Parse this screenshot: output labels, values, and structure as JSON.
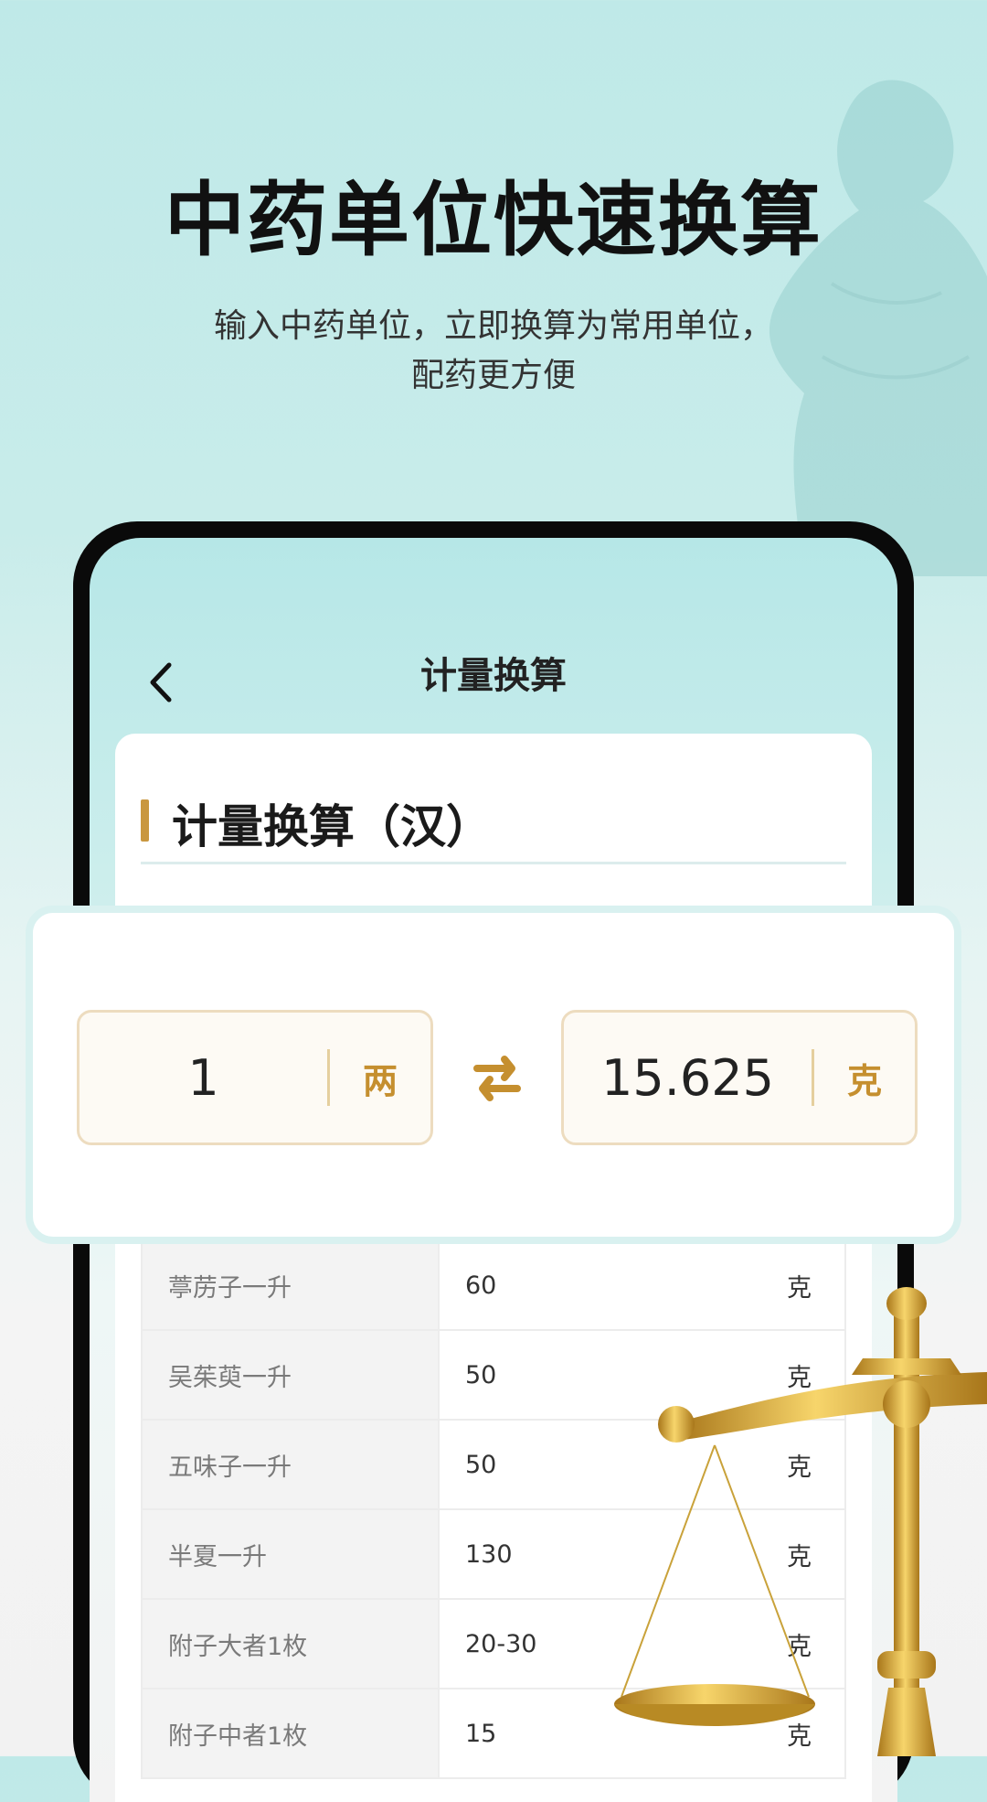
{
  "headline": "中药单位快速换算",
  "subline_1": "输入中药单位，立即换算为常用单位，",
  "subline_2": "配药更方便",
  "nav": {
    "title": "计量换算",
    "back_icon": "chevron-left-icon"
  },
  "card": {
    "title": "计量换算（汉）"
  },
  "converter": {
    "from_value": "1",
    "from_unit": "两",
    "to_value": "15.625",
    "to_unit": "克",
    "swap_icon": "swap-arrows-icon"
  },
  "table": {
    "rows": [
      {
        "name": "葶苈子一升",
        "value": "60",
        "unit": "克"
      },
      {
        "name": "吴茱萸一升",
        "value": "50",
        "unit": "克"
      },
      {
        "name": "五味子一升",
        "value": "50",
        "unit": "克"
      },
      {
        "name": "半夏一升",
        "value": "130",
        "unit": "克"
      },
      {
        "name": "附子大者1枚",
        "value": "20-30",
        "unit": "克"
      },
      {
        "name": "附子中者1枚",
        "value": "15",
        "unit": "克"
      }
    ]
  },
  "colors": {
    "accent_gold": "#c9973f",
    "bg_teal": "#bfe9e8"
  }
}
